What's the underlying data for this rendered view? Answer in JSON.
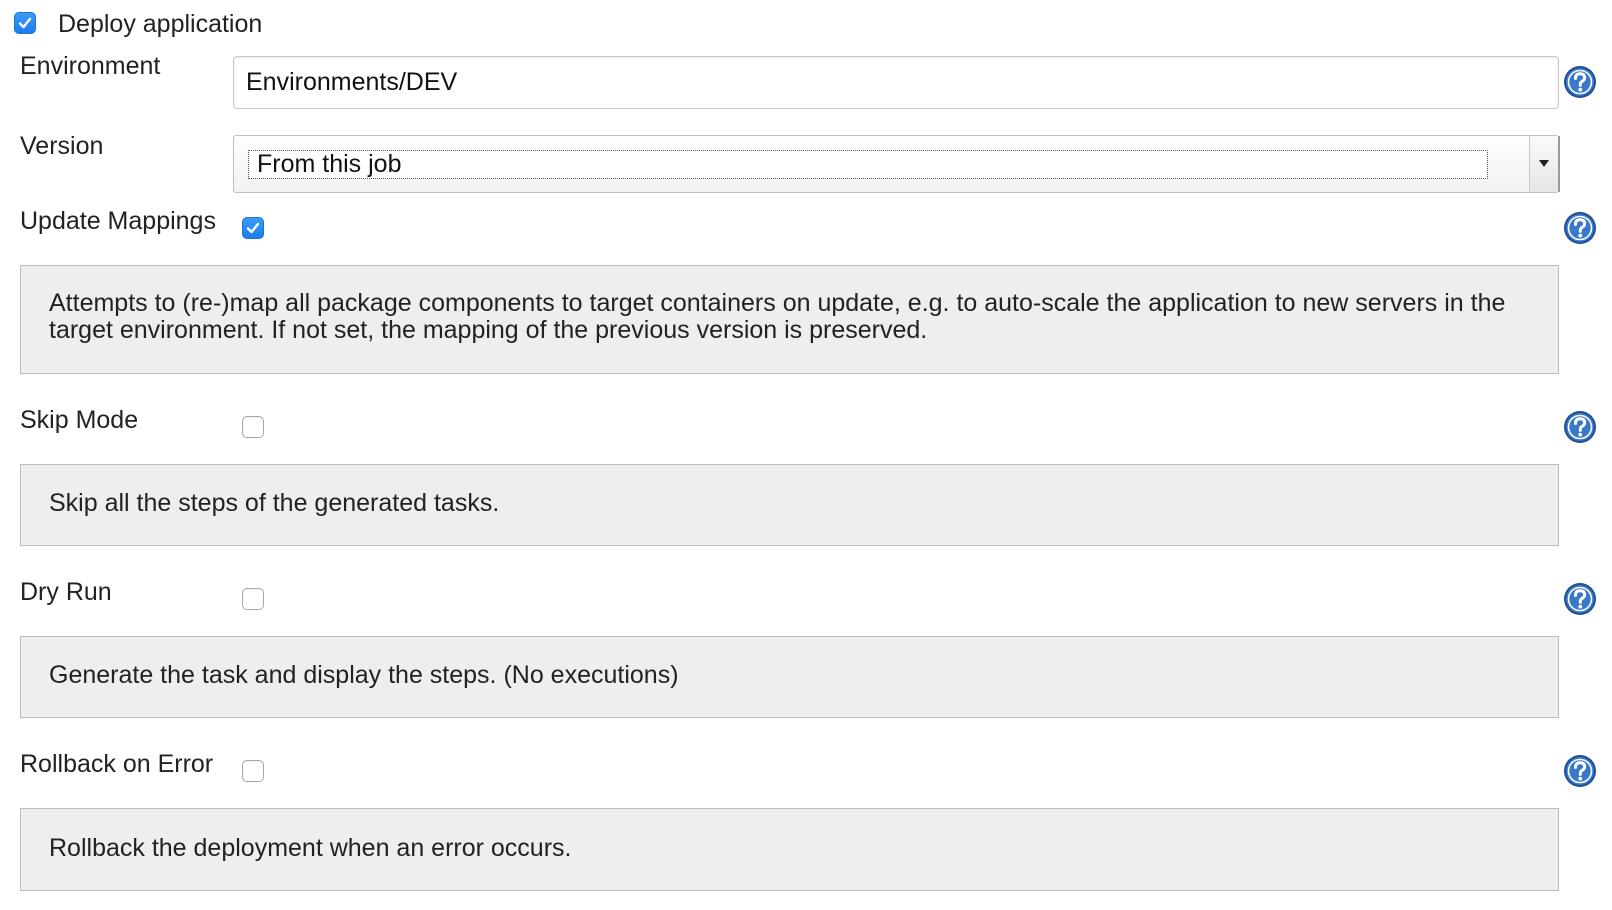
{
  "deploy": {
    "label": "Deploy application",
    "checked": true
  },
  "environment": {
    "label": "Environment",
    "value": "Environments/DEV"
  },
  "version": {
    "label": "Version",
    "selected": "From this job"
  },
  "update_mappings": {
    "label": "Update Mappings",
    "checked": true,
    "description": "Attempts to (re-)map all package components to target containers on update, e.g. to auto-scale the application to new servers in the target environment. If not set, the mapping of the previous version is preserved."
  },
  "skip_mode": {
    "label": "Skip Mode",
    "checked": false,
    "description": "Skip all the steps of the generated tasks."
  },
  "dry_run": {
    "label": "Dry Run",
    "checked": false,
    "description": "Generate the task and display the steps. (No executions)"
  },
  "rollback": {
    "label": "Rollback on Error",
    "checked": false,
    "description": "Rollback the deployment when an error occurs."
  },
  "icons": {
    "help": "help-icon",
    "check": "checkmark-icon",
    "dropdown": "chevron-down-icon"
  },
  "colors": {
    "checkbox_accent": "#1a7cf0",
    "help_icon": "#2d63ad",
    "description_bg": "#eeeeee"
  }
}
